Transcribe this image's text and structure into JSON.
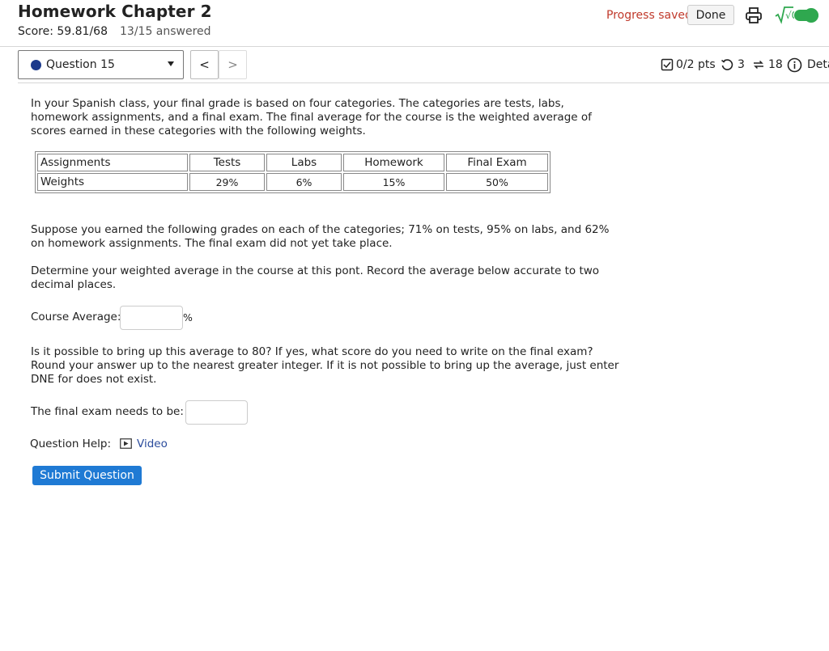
{
  "header": {
    "title": "Homework Chapter 2",
    "score": "Score: 59.81/68",
    "answered": "13/15 answered",
    "progress_status": "Progress saved",
    "done_label": "Done",
    "math_label": "√0"
  },
  "question_nav": {
    "selected": "Question 15",
    "prev_label": "<",
    "next_label": ">"
  },
  "question_meta": {
    "points": "0/2 pts",
    "retries": "3",
    "attempts": "18",
    "details": "Deta"
  },
  "question": {
    "intro": "In your Spanish class, your final grade is based on four categories. The categories are tests, labs, homework assignments, and a final exam. The final average for the course is the weighted average of scores earned in these categories with the following weights.",
    "table": {
      "headers": [
        "Assignments",
        "Tests",
        "Labs",
        "Homework",
        "Final Exam"
      ],
      "rows": [
        [
          "Weights",
          "29%",
          "6%",
          "15%",
          "50%"
        ]
      ]
    },
    "grades_text": "Suppose you earned the following grades on each of the categories; 71% on tests, 95% on labs, and 62% on homework assignments. The final exam did not yet take place.",
    "determine_text": "Determine your weighted average in the course at this pont. Record the average below accurate to two decimal places.",
    "course_average_label": "Course Average:",
    "percent_sign": "%",
    "possible_text": "Is it possible to bring up this average to 80? If yes, what score do you need to write on the final exam? Round your answer up to the nearest greater integer. If it is not possible to bring up the average, just enter DNE for does not exist.",
    "final_exam_label": "The final exam needs to be:",
    "help_label": "Question Help:",
    "video_label": "Video",
    "submit_label": "Submit Question"
  },
  "colors": {
    "progress": "#c0392b",
    "toggle": "#2fa84f",
    "submit": "#1f7ad4",
    "link": "#2a4b9c"
  }
}
